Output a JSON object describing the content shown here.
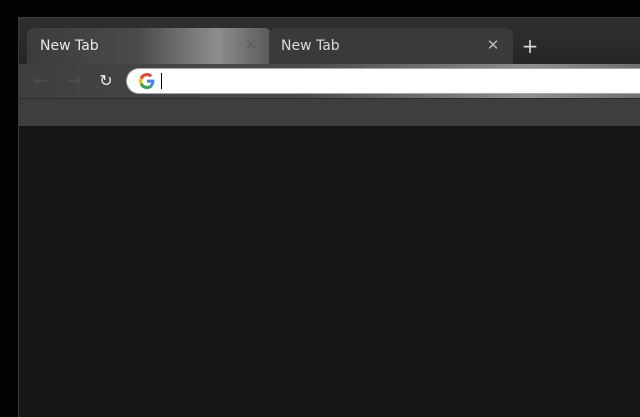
{
  "tabs": [
    {
      "title": "New Tab",
      "active": true,
      "close_icon": "close-icon"
    },
    {
      "title": "New Tab",
      "active": false,
      "close_icon": "close-icon"
    }
  ],
  "new_tab_icon": "plus-icon",
  "toolbar": {
    "back_icon": "arrow-left-icon",
    "forward_icon": "arrow-right-icon",
    "reload_icon": "reload-icon",
    "omnibox": {
      "value": "",
      "search_engine_icon": "google-g-icon"
    }
  },
  "colors": {
    "frame": "#2f2f31",
    "content_background": "#161618",
    "omnibox_background": "#ffffff"
  }
}
